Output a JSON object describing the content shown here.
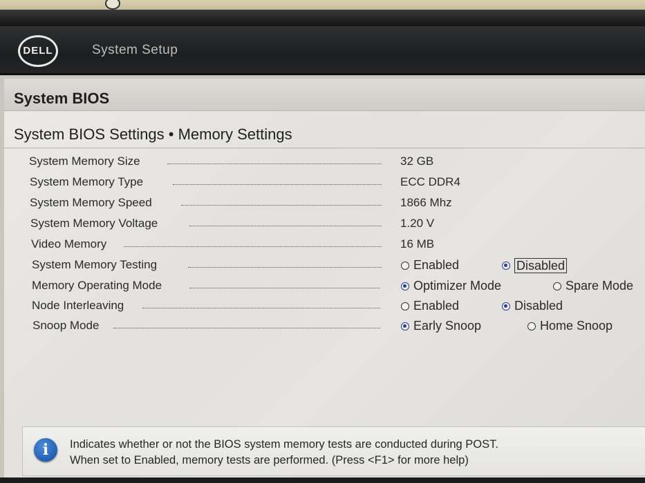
{
  "header": {
    "logo_text": "DELL",
    "title": "System Setup"
  },
  "page": {
    "title": "System BIOS",
    "section_title": "System BIOS Settings • Memory Settings"
  },
  "settings": [
    {
      "label": "System Memory Size",
      "value": "32 GB"
    },
    {
      "label": "System Memory Type",
      "value": "ECC DDR4"
    },
    {
      "label": "System Memory Speed",
      "value": "1866 Mhz"
    },
    {
      "label": "System Memory Voltage",
      "value": "1.20 V"
    },
    {
      "label": "Video Memory",
      "value": "16 MB"
    }
  ],
  "radio_settings": [
    {
      "label": "System Memory Testing",
      "options": [
        "Enabled",
        "Disabled"
      ],
      "selected": "Disabled"
    },
    {
      "label": "Memory Operating Mode",
      "options": [
        "Optimizer Mode",
        "Spare Mode"
      ],
      "selected": "Optimizer Mode"
    },
    {
      "label": "Node Interleaving",
      "options": [
        "Enabled",
        "Disabled"
      ],
      "selected": "Disabled"
    },
    {
      "label": "Snoop Mode",
      "options": [
        "Early Snoop",
        "Home Snoop"
      ],
      "selected": "Early Snoop"
    }
  ],
  "help": {
    "icon": "info-icon",
    "line1": "Indicates whether or not the BIOS system memory tests are conducted during POST.",
    "line2": "When set to Enabled, memory tests are performed. (Press <F1> for more help)"
  },
  "colors": {
    "header_bg": "#1c1e20",
    "radio_selected": "#2a3f8f",
    "info_icon": "#1f5fb3"
  }
}
